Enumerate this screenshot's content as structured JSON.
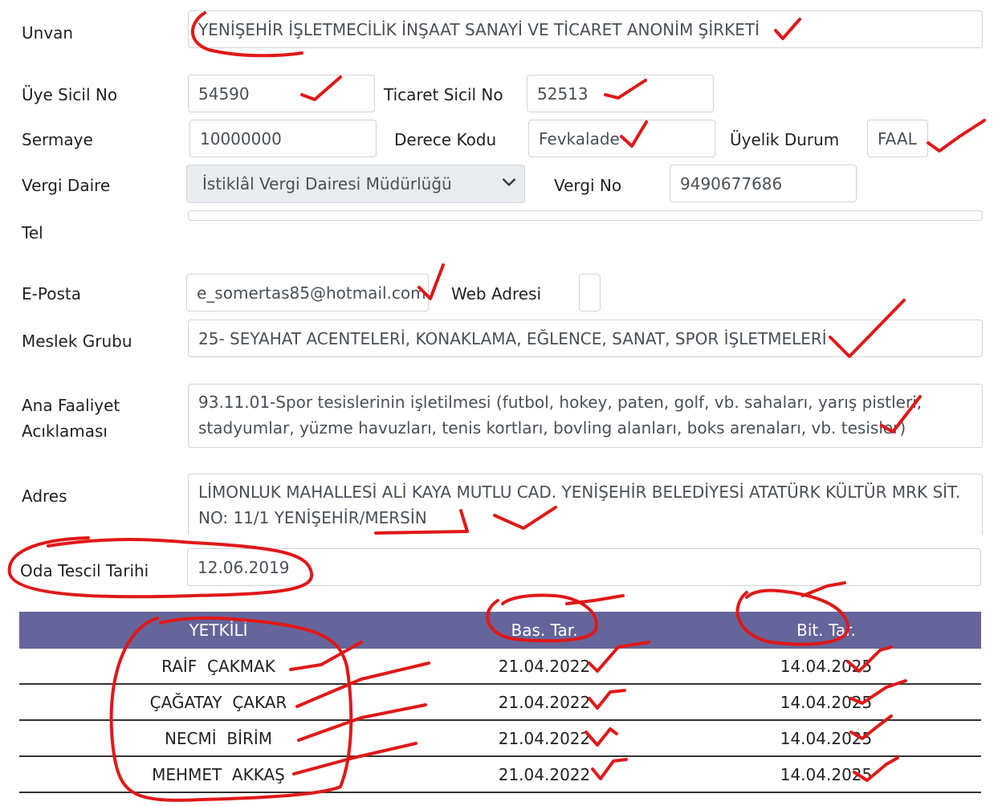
{
  "form": {
    "unvan": {
      "label": "Unvan",
      "value": "YENİŞEHİR İŞLETMECİLİK İNŞAAT SANAYİ VE TİCARET ANONİM ŞİRKETİ"
    },
    "uye_sicil_no": {
      "label": "Üye Sicil No",
      "value": "54590"
    },
    "ticaret_sicil_no": {
      "label": "Ticaret Sicil No",
      "value": "52513"
    },
    "sermaye": {
      "label": "Sermaye",
      "value": "10000000"
    },
    "derece_kodu": {
      "label": "Derece Kodu",
      "value": "Fevkalade"
    },
    "uyelik_durum": {
      "label": "Üyelik Durum",
      "value": "FAAL"
    },
    "vergi_daire": {
      "label": "Vergi Daire",
      "value": "İstiklâl Vergi Dairesi Müdürlüğü"
    },
    "vergi_no": {
      "label": "Vergi No",
      "value": "9490677686"
    },
    "tel": {
      "label": "Tel",
      "value": ""
    },
    "e_posta": {
      "label": "E-Posta",
      "value": "e_somertas85@hotmail.com"
    },
    "web_adresi": {
      "label": "Web Adresi",
      "value": ""
    },
    "meslek_grubu": {
      "label": "Meslek Grubu",
      "value": "25- SEYAHAT ACENTELERİ, KONAKLAMA, EĞLENCE, SANAT, SPOR İŞLETMELERİ"
    },
    "ana_faaliyet": {
      "label_line1": "Ana Faaliyet",
      "label_line2": "Acıklaması",
      "value": "93.11.01-Spor tesislerinin işletilmesi (futbol, hokey, paten, golf, vb. sahaları, yarış pistleri, stadyumlar, yüzme havuzları, tenis kortları, bovling alanları, boks arenaları, vb. tesisler)"
    },
    "adres": {
      "label": "Adres",
      "value": "LİMONLUK MAHALLESİ ALİ KAYA MUTLU CAD. YENİŞEHİR BELEDİYESİ ATATÜRK KÜLTÜR MRK SİT. NO: 11/1 YENİŞEHİR/MERSİN"
    },
    "oda_tescil_tarihi": {
      "label": "Oda Tescil Tarihi",
      "value": "12.06.2019"
    }
  },
  "yetkili_table": {
    "headers": [
      "YETKİLİ",
      "Bas. Tar.",
      "Bit. Tar."
    ],
    "rows": [
      [
        "RAİF  ÇAKMAK",
        "21.04.2022",
        "14.04.2025"
      ],
      [
        "ÇAĞATAY  ÇAKAR",
        "21.04.2022",
        "14.04.2025"
      ],
      [
        "NECMİ  BİRİM",
        "21.04.2022",
        "14.04.2025"
      ],
      [
        "MEHMET  AKKAŞ",
        "21.04.2022",
        "14.04.2025"
      ]
    ]
  },
  "icons": {
    "select_chevron": "chevron-down-icon"
  },
  "colors": {
    "table_header_bg": "#65659b",
    "annotation_ink": "#e01818",
    "select_bg": "#e9ecef"
  }
}
